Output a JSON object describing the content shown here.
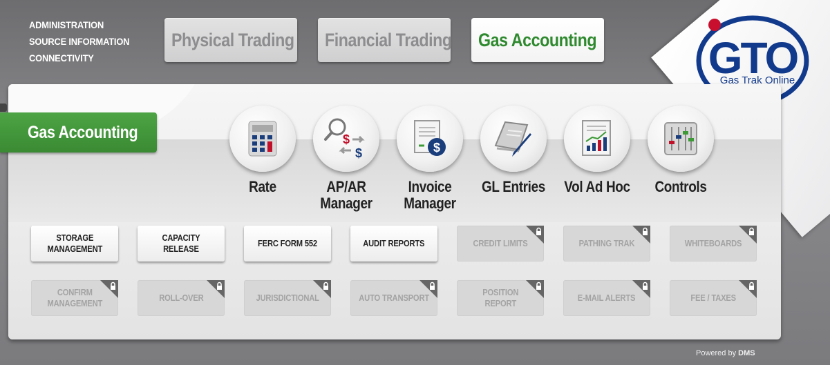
{
  "top_links": [
    "ADMINISTRATION",
    "SOURCE INFORMATION",
    "CONNECTIVITY"
  ],
  "tabs": [
    {
      "label": "Physical Trading",
      "active": false
    },
    {
      "label": "Financial Trading",
      "active": false
    },
    {
      "label": "Gas Accounting",
      "active": true
    }
  ],
  "logo": {
    "text": "GTO",
    "tagline": "Gas Trak Online"
  },
  "section_title": "Gas Accounting",
  "modules": [
    {
      "label": "Rate",
      "icon": "calculator-icon"
    },
    {
      "label": "AP/AR\nManager",
      "icon": "ap-ar-exchange-icon"
    },
    {
      "label": "Invoice\nManager",
      "icon": "invoice-icon"
    },
    {
      "label": "GL Entries",
      "icon": "ledger-pen-icon"
    },
    {
      "label": "Vol Ad Hoc",
      "icon": "report-chart-icon"
    },
    {
      "label": "Controls",
      "icon": "sliders-icon"
    }
  ],
  "buttons_row1": [
    {
      "label": "STORAGE\nMANAGEMENT",
      "locked": false
    },
    {
      "label": "CAPACITY\nRELEASE",
      "locked": false
    },
    {
      "label": "FERC FORM 552",
      "locked": false
    },
    {
      "label": "AUDIT REPORTS",
      "locked": false
    },
    {
      "label": "CREDIT LIMITS",
      "locked": true
    },
    {
      "label": "PATHING TRAK",
      "locked": true
    },
    {
      "label": "WHITEBOARDS",
      "locked": true
    }
  ],
  "buttons_row2": [
    {
      "label": "CONFIRM\nMANAGEMENT",
      "locked": true
    },
    {
      "label": "ROLL-OVER",
      "locked": true
    },
    {
      "label": "JURISDICTIONAL",
      "locked": true
    },
    {
      "label": "AUTO TRANSPORT",
      "locked": true
    },
    {
      "label": "POSITION\nREPORT",
      "locked": true
    },
    {
      "label": "E-MAIL ALERTS",
      "locked": true
    },
    {
      "label": "FEE / TAXES",
      "locked": true
    }
  ],
  "footer": {
    "prefix": "Powered by",
    "brand": "DMS"
  },
  "colors": {
    "accent_green": "#3d9a36",
    "logo_blue": "#123a8c",
    "logo_red": "#c8102e",
    "dollar_red": "#c0102a",
    "dollar_blue": "#1a3d7c"
  }
}
